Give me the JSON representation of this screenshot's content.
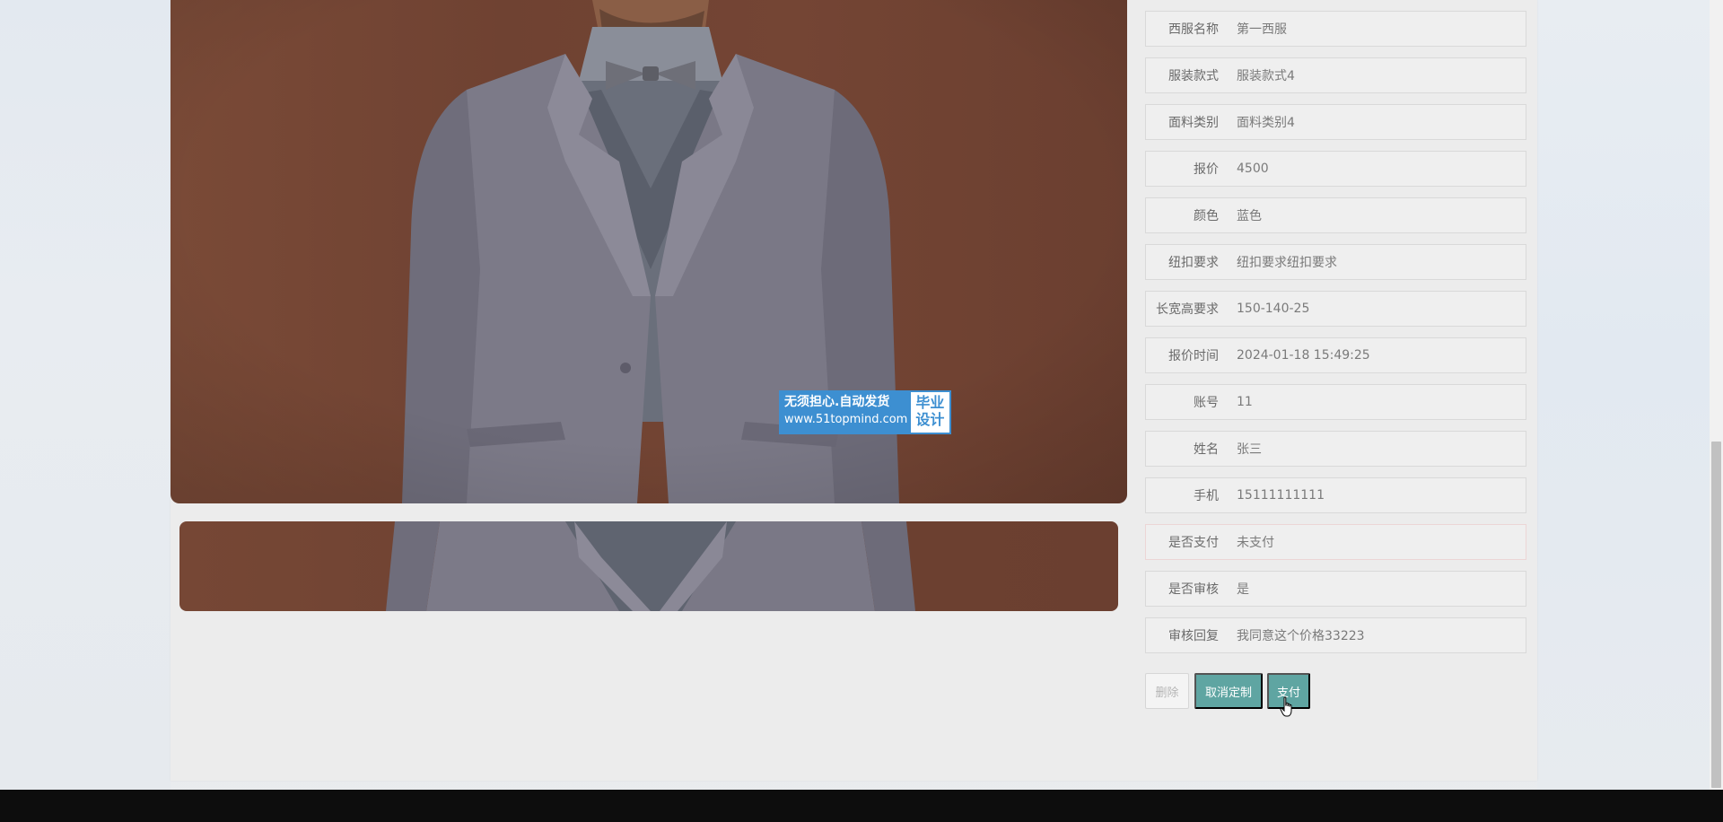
{
  "product": {
    "image_alt": "suit-model-photo",
    "watermark": {
      "line1": "无须担心.自动发货",
      "line2": "www.51topmind.com",
      "right": "毕业设计"
    }
  },
  "details": [
    {
      "label": "西服名称",
      "value": "第一西服"
    },
    {
      "label": "服装款式",
      "value": "服装款式4"
    },
    {
      "label": "面料类别",
      "value": "面料类别4"
    },
    {
      "label": "报价",
      "value": "4500"
    },
    {
      "label": "颜色",
      "value": "蓝色"
    },
    {
      "label": "纽扣要求",
      "value": "纽扣要求纽扣要求"
    },
    {
      "label": "长宽高要求",
      "value": "150-140-25"
    },
    {
      "label": "报价时间",
      "value": "2024-01-18 15:49:25"
    },
    {
      "label": "账号",
      "value": "11"
    },
    {
      "label": "姓名",
      "value": "张三"
    },
    {
      "label": "手机",
      "value": "15111111111"
    },
    {
      "label": "是否支付",
      "value": "未支付"
    },
    {
      "label": "是否审核",
      "value": "是"
    },
    {
      "label": "审核回复",
      "value": "我同意这个价格33223"
    }
  ],
  "actions": {
    "delete_label": "删除",
    "cancel_label": "取消定制",
    "pay_label": "支付"
  },
  "colors": {
    "accent": "#5fa5a2",
    "watermark_blue": "#3d8fd1"
  }
}
